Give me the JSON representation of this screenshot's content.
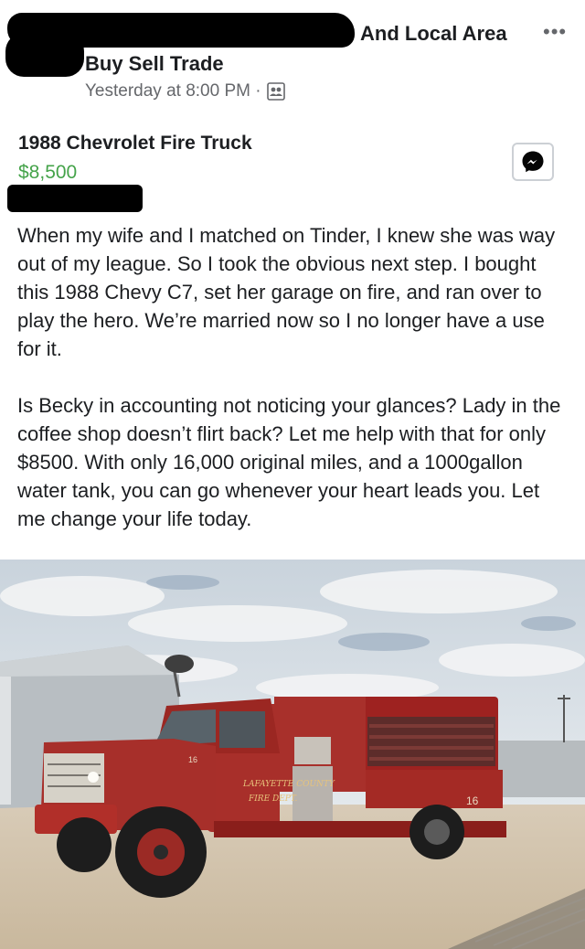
{
  "header": {
    "group_name": "And Local Area",
    "group_subtitle": "Buy Sell Trade",
    "timestamp": "Yesterday at 8:00 PM ·",
    "more_icon": "more-horizontal-icon",
    "audience_icon": "group-members-icon"
  },
  "listing": {
    "title": "1988 Chevrolet Fire Truck",
    "price": "$8,500",
    "price_color": "#45a34a",
    "messenger_icon": "messenger-icon"
  },
  "post": {
    "paragraph1": "When my wife and I matched on Tinder, I knew she was way out of my league. So I took the obvious next step. I bought this 1988 Chevy C7, set her garage on fire, and ran over to play the hero. We’re married now so I no longer have a use for it.",
    "paragraph2": "Is Becky in accounting not noticing your glances? Lady in the coffee shop doesn’t flirt back? Let me help with that for only $8500. With only 16,000 original miles, and a 1000gallon water tank, you can go whenever your heart leads you. Let me change your life today."
  },
  "photo": {
    "door_text_1": "LAFAYETTE COUNTY",
    "door_text_2": "FIRE DEPT.",
    "unit_number": "16",
    "rear_number": "16"
  }
}
